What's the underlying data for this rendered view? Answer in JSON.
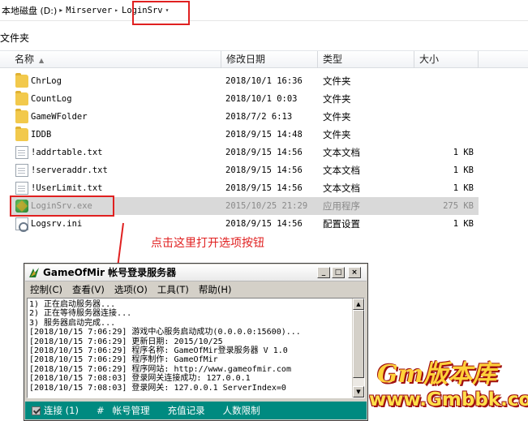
{
  "breadcrumb": {
    "items": [
      "本地磁盘 (D:)",
      "Mirserver",
      "LoginSrv"
    ]
  },
  "folder_label": "文件夹",
  "columns": {
    "name": "名称",
    "date": "修改日期",
    "type": "类型",
    "size": "大小"
  },
  "files": [
    {
      "name": "ChrLog",
      "date": "2018/10/1 16:36",
      "type": "文件夹",
      "size": "",
      "icon": "folder-icon"
    },
    {
      "name": "CountLog",
      "date": "2018/10/1 0:03",
      "type": "文件夹",
      "size": "",
      "icon": "folder-icon"
    },
    {
      "name": "GameWFolder",
      "date": "2018/7/2 6:13",
      "type": "文件夹",
      "size": "",
      "icon": "folder-icon"
    },
    {
      "name": "IDDB",
      "date": "2018/9/15 14:48",
      "type": "文件夹",
      "size": "",
      "icon": "folder-icon"
    },
    {
      "name": "!addrtable.txt",
      "date": "2018/9/15 14:56",
      "type": "文本文档",
      "size": "1 KB",
      "icon": "text-file-icon"
    },
    {
      "name": "!serveraddr.txt",
      "date": "2018/9/15 14:56",
      "type": "文本文档",
      "size": "1 KB",
      "icon": "text-file-icon"
    },
    {
      "name": "!UserLimit.txt",
      "date": "2018/9/15 14:56",
      "type": "文本文档",
      "size": "1 KB",
      "icon": "text-file-icon"
    },
    {
      "name": "LoginSrv.exe",
      "date": "2015/10/25 21:29",
      "type": "应用程序",
      "size": "275 KB",
      "icon": "app-exe-icon",
      "selected": true
    },
    {
      "name": "Logsrv.ini",
      "date": "2018/9/15 14:56",
      "type": "配置设置",
      "size": "1 KB",
      "icon": "config-file-icon"
    }
  ],
  "instruction": "点击这里打开选项按钮",
  "app_window": {
    "title": "GameOfMir 帐号登录服务器",
    "menu": [
      "控制(C)",
      "查看(V)",
      "选项(O)",
      "工具(T)",
      "帮助(H)"
    ],
    "log_lines": [
      "1) 正在启动服务器...",
      "2) 正在等待服务器连接...",
      "3) 服务器启动完成...",
      "[2018/10/15 7:06:29] 游戏中心服务启动成功(0.0.0.0:15600)...",
      "[2018/10/15 7:06:29] 更新日期: 2015/10/25",
      "[2018/10/15 7:06:29] 程序名称: GameOfMir登录服务器 V 1.0",
      "[2018/10/15 7:06:29] 程序制作: GameOfMir",
      "[2018/10/15 7:06:29] 程序网站: http://www.gameofmir.com",
      "[2018/10/15 7:08:03] 登录网关连接成功: 127.0.0.1",
      "[2018/10/15 7:08:03] 登录网关: 127.0.0.1 ServerIndex=0"
    ],
    "status": {
      "connect_label": "连接 (1)",
      "hash": "#",
      "items": [
        "帐号管理",
        "充值记录",
        "人数限制"
      ]
    }
  },
  "watermark": {
    "line1": "Gm版本库",
    "line2": "www.Gmbbk.com"
  },
  "colors": {
    "highlight_red": "#e02020",
    "status_teal": "#008a80",
    "selected_row": "#d9d9d9"
  }
}
